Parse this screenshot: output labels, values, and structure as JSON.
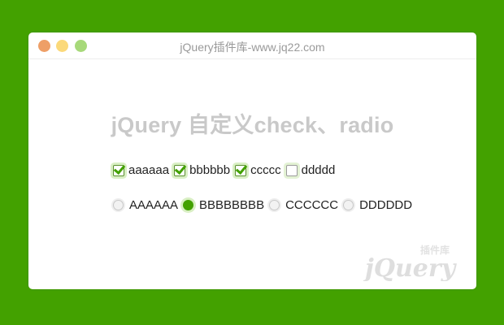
{
  "window": {
    "title": "jQuery插件库-www.jq22.com"
  },
  "heading": "jQuery 自定义check、radio",
  "checkboxes": [
    {
      "label": "aaaaaa",
      "checked": true
    },
    {
      "label": "bbbbbb",
      "checked": true
    },
    {
      "label": "ccccc",
      "checked": true
    },
    {
      "label": "ddddd",
      "checked": false
    }
  ],
  "radios": [
    {
      "label": "AAAAAA",
      "selected": false
    },
    {
      "label": "BBBBBBBB",
      "selected": true
    },
    {
      "label": "CCCCCC",
      "selected": false
    },
    {
      "label": "DDDDDD",
      "selected": false
    }
  ],
  "watermark": {
    "text": "插件库",
    "brand": "jQuery"
  },
  "colors": {
    "background": "#43a100",
    "accent": "#43a100"
  }
}
